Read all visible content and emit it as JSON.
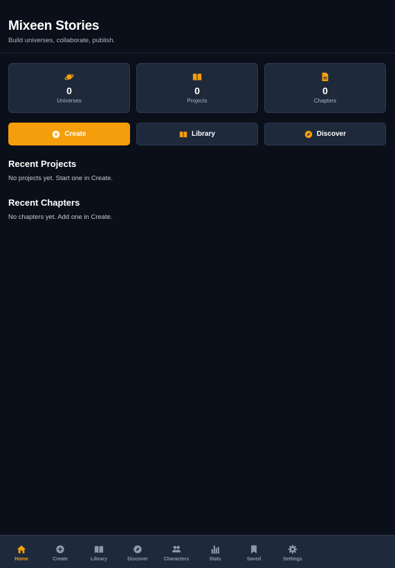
{
  "header": {
    "title": "Mixeen Stories",
    "subtitle": "Build universes, collaborate, publish."
  },
  "stats": [
    {
      "icon": "planet-icon",
      "value": "0",
      "label": "Universes"
    },
    {
      "icon": "book-icon",
      "value": "0",
      "label": "Projects"
    },
    {
      "icon": "document-icon",
      "value": "0",
      "label": "Chapters"
    }
  ],
  "actions": [
    {
      "icon": "plus-circle-icon",
      "label": "Create"
    },
    {
      "icon": "book-icon",
      "label": "Library"
    },
    {
      "icon": "compass-icon",
      "label": "Discover"
    }
  ],
  "recent_projects": {
    "title": "Recent Projects",
    "empty_text": "No projects yet. Start one in Create."
  },
  "recent_chapters": {
    "title": "Recent Chapters",
    "empty_text": "No chapters yet. Add one in Create."
  },
  "nav": {
    "active": "Home",
    "items": [
      {
        "icon": "home-icon",
        "label": "Home"
      },
      {
        "icon": "plus-circle-icon",
        "label": "Create"
      },
      {
        "icon": "book-icon",
        "label": "Library"
      },
      {
        "icon": "compass-icon",
        "label": "Discover"
      },
      {
        "icon": "users-icon",
        "label": "Characters"
      },
      {
        "icon": "bar-chart-icon",
        "label": "Stats"
      },
      {
        "icon": "bookmark-icon",
        "label": "Saved"
      },
      {
        "icon": "gear-icon",
        "label": "Settings"
      }
    ]
  },
  "colors": {
    "background": "#0b0f19",
    "card": "#1e293b",
    "accent": "#f59e0b",
    "nav_inactive": "#8f99aa"
  }
}
